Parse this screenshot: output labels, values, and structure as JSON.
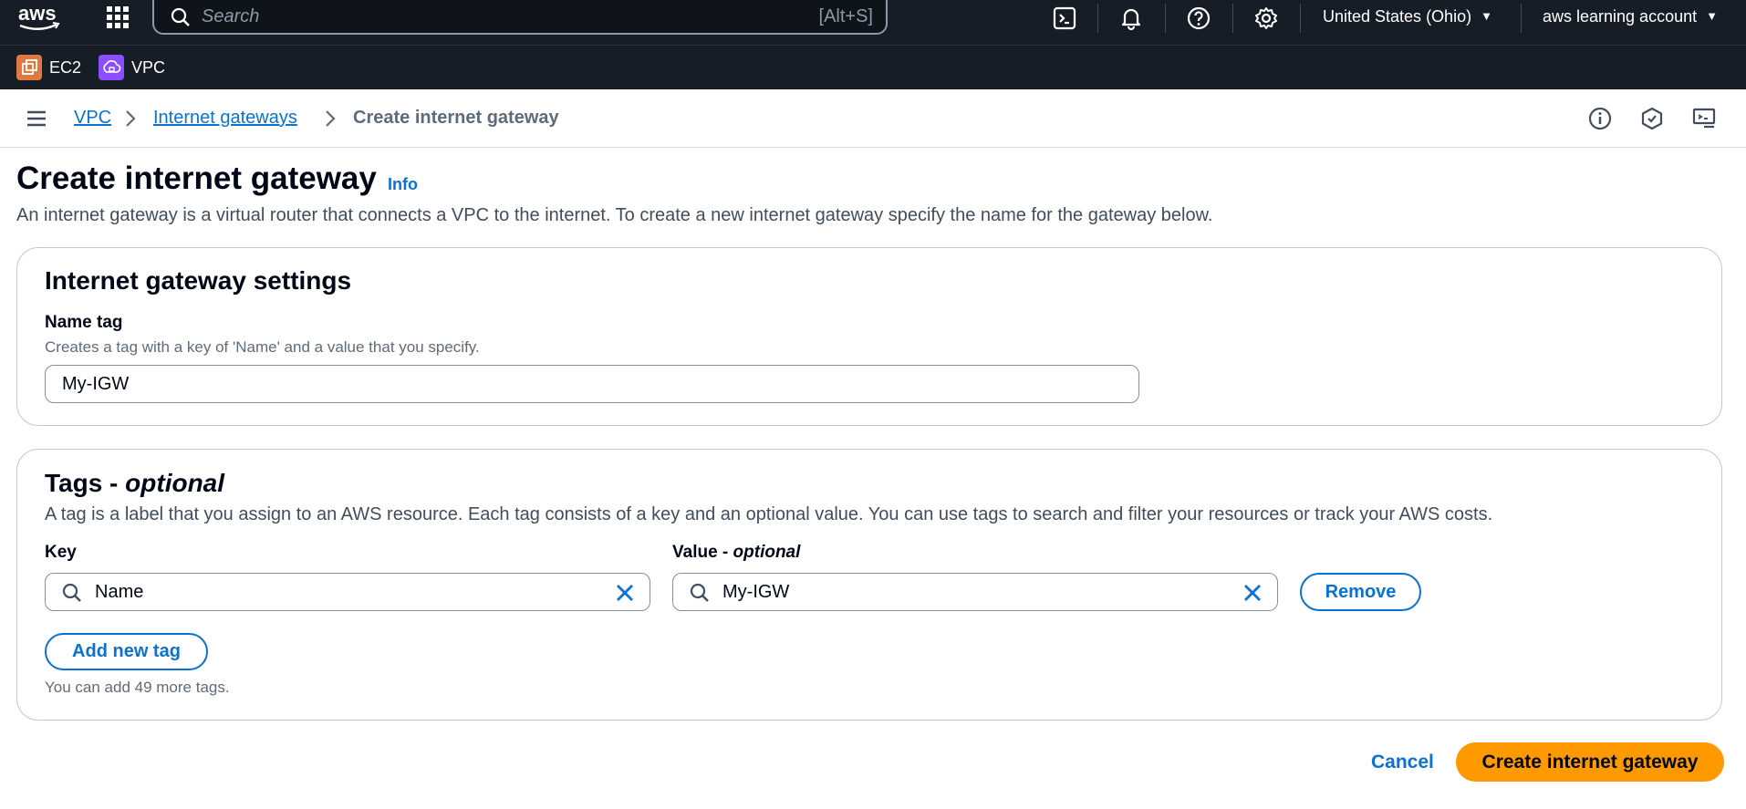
{
  "topnav": {
    "logo": "aws",
    "search_placeholder": "Search",
    "search_shortcut": "[Alt+S]",
    "region": "United States (Ohio)",
    "account": "aws learning account",
    "icons": [
      "apps-grid-icon",
      "cloudshell-icon",
      "bell-icon",
      "help-icon",
      "gear-icon"
    ]
  },
  "servicebar": {
    "items": [
      {
        "label": "EC2",
        "color": "#e07941"
      },
      {
        "label": "VPC",
        "color": "#8c4fff"
      }
    ]
  },
  "breadcrumb": {
    "items": [
      "VPC",
      "Internet gateways"
    ],
    "current": "Create internet gateway"
  },
  "header": {
    "title": "Create internet gateway",
    "info": "Info",
    "description": "An internet gateway is a virtual router that connects a VPC to the internet. To create a new internet gateway specify the name for the gateway below."
  },
  "settings": {
    "heading": "Internet gateway settings",
    "name_label": "Name tag",
    "name_description": "Creates a tag with a key of 'Name' and a value that you specify.",
    "name_value": "My-IGW"
  },
  "tags": {
    "heading": "Tags - ",
    "heading_optional": "optional",
    "description": "A tag is a label that you assign to an AWS resource. Each tag consists of a key and an optional value. You can use tags to search and filter your resources or track your AWS costs.",
    "key_label": "Key",
    "value_label": "Value - ",
    "value_optional": "optional",
    "rows": [
      {
        "key": "Name",
        "value": "My-IGW"
      }
    ],
    "remove_label": "Remove",
    "add_label": "Add new tag",
    "hint": "You can add 49 more tags."
  },
  "footer": {
    "cancel": "Cancel",
    "submit": "Create internet gateway"
  },
  "colors": {
    "accent": "#0972d3",
    "primary_button": "#ff9900",
    "nav_bg": "#161d26"
  }
}
